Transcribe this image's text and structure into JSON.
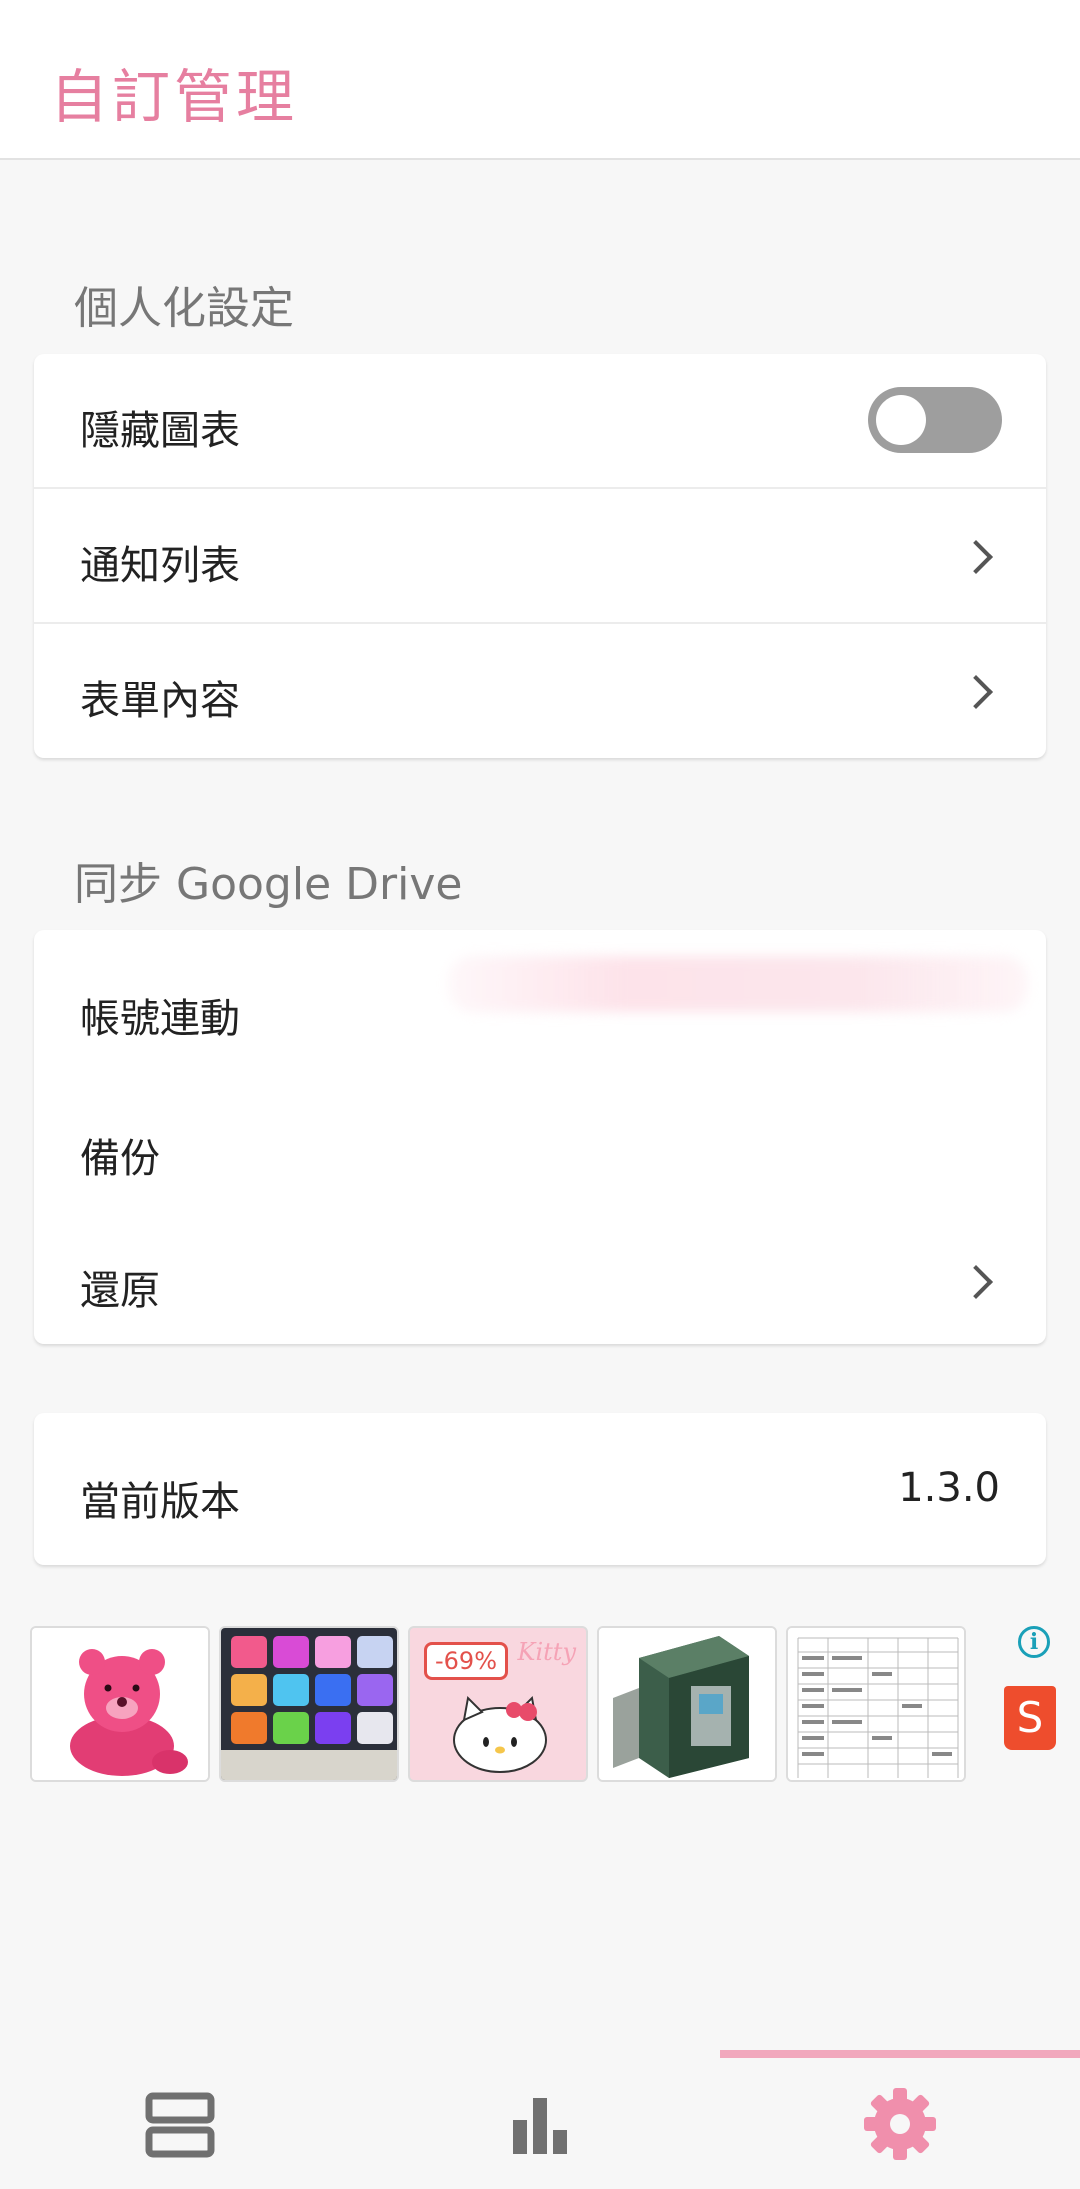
{
  "header": {
    "title": "自訂管理"
  },
  "personalization": {
    "section_label": "個人化設定",
    "hide_chart_label": "隱藏圖表",
    "hide_chart_on": false,
    "notification_list_label": "通知列表",
    "form_content_label": "表單內容"
  },
  "sync": {
    "section_label": "同步 Google Drive",
    "account_link_label": "帳號連動",
    "backup_label": "備份",
    "restore_label": "還原"
  },
  "version": {
    "label": "當前版本",
    "value": "1.3.0"
  },
  "ads": {
    "discount_badge": "-69%",
    "kitty_text": "Kitty",
    "info_glyph": "i",
    "shop_glyph": "S"
  },
  "bottom_nav": {
    "active_tab": "settings",
    "tabs": [
      {
        "icon": "list-icon"
      },
      {
        "icon": "bar-chart-icon"
      },
      {
        "icon": "gear-icon"
      }
    ]
  },
  "colors": {
    "accent": "#e67fa0",
    "indicator": "#f1a8bd",
    "toggle_off": "#9e9e9e"
  }
}
